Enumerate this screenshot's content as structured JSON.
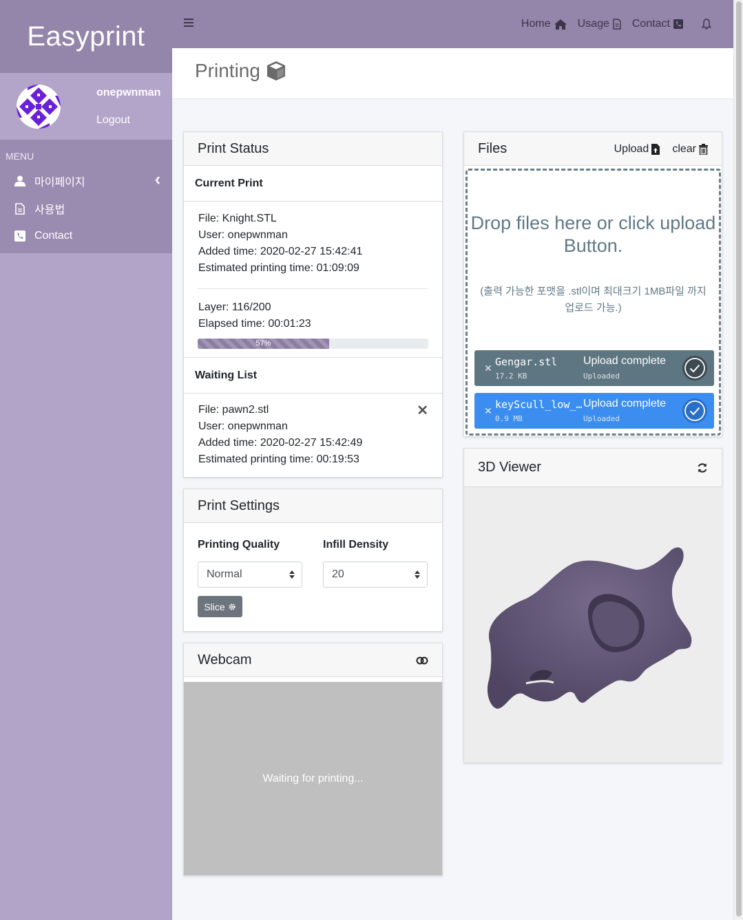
{
  "brand": {
    "title": "Easyprint"
  },
  "user": {
    "name": "onepwnman",
    "logout_label": "Logout"
  },
  "menu": {
    "header": "MENU",
    "items": [
      {
        "label": "마이페이지",
        "icon": "user-icon"
      },
      {
        "label": "사용법",
        "icon": "document-icon"
      },
      {
        "label": "Contact",
        "icon": "phone-icon"
      }
    ]
  },
  "topnav": {
    "home": "Home",
    "usage": "Usage",
    "contact": "Contact"
  },
  "page": {
    "title": "Printing"
  },
  "print_status": {
    "title": "Print Status",
    "current_label": "Current Print",
    "file": "File: Knight.STL",
    "user": "User: onepwnman",
    "added": "Added time: 2020-02-27 15:42:41",
    "estimated": "Estimated printing time: 01:09:09",
    "layer": "Layer: 116/200",
    "elapsed": "Elapsed time: 00:01:23",
    "progress_label": "57%",
    "progress_value": 57,
    "waiting_label": "Waiting List",
    "waiting": {
      "file": "File: pawn2.stl",
      "user": "User: onepwnman",
      "added": "Added time: 2020-02-27 15:42:49",
      "estimated": "Estimated printing time: 00:19:53"
    }
  },
  "print_settings": {
    "title": "Print Settings",
    "quality_label": "Printing Quality",
    "quality_value": "Normal",
    "infill_label": "Infill Density",
    "infill_value": "20",
    "slice_label": "Slice"
  },
  "webcam": {
    "title": "Webcam",
    "message": "Waiting for printing..."
  },
  "files": {
    "title": "Files",
    "upload_label": "Upload",
    "clear_label": "clear",
    "drop_message": "Drop files here or click upload Button.",
    "drop_note": "(출력 가능한 포맷을 .stl이며 최대크기 1MB파일 까지 업로드 가능.)",
    "list": [
      {
        "name": "Gengar.stl",
        "size": "17.2 KB",
        "status": "Upload complete",
        "sub": "Uploaded",
        "color": "#5e7682"
      },
      {
        "name": "keyScull_low_poly.stl",
        "size": "0.9 MB",
        "status": "Upload complete",
        "sub": "Uploaded",
        "color": "#3b8ef0"
      }
    ]
  },
  "viewer": {
    "title": "3D Viewer",
    "model_color": "#5f5471"
  },
  "colors": {
    "sidebar": "#b2a4c8",
    "topbar": "#9486aa",
    "accent": "#8c7da3"
  }
}
